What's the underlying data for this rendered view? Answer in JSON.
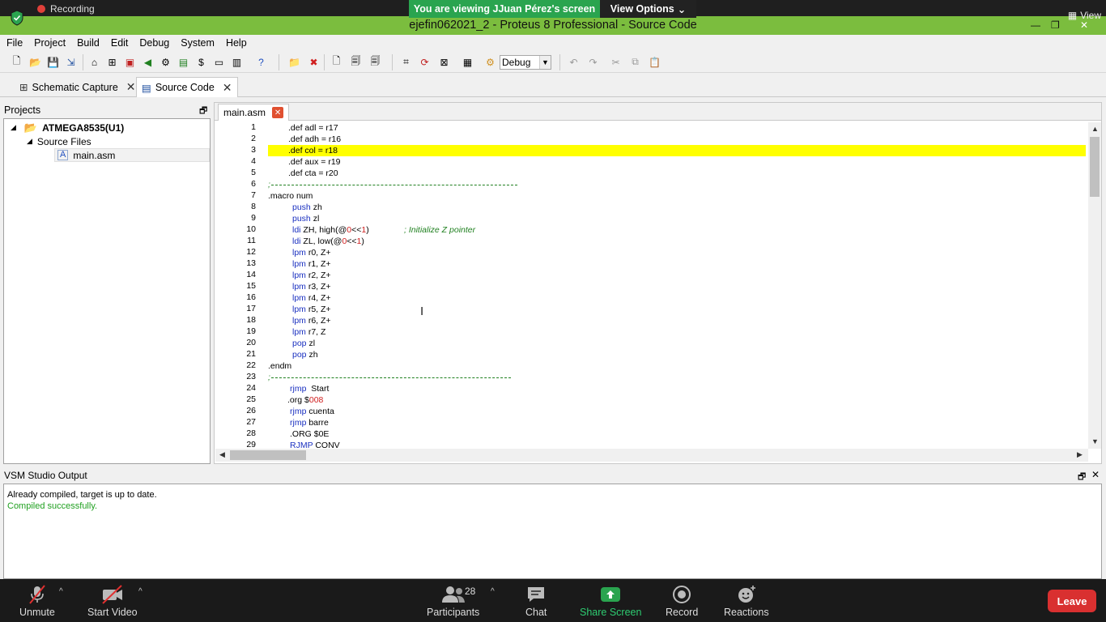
{
  "share_bar": {
    "recording": "Recording",
    "viewing": "You are viewing JJuan Pérez's screen",
    "view_options": "View Options",
    "view": "View"
  },
  "window": {
    "title": "ejefin062021_2 - Proteus 8 Professional - Source Code"
  },
  "menu": [
    "File",
    "Project",
    "Build",
    "Edit",
    "Debug",
    "System",
    "Help"
  ],
  "toolbar": {
    "config": "Debug"
  },
  "doc_tabs": [
    {
      "label": "Schematic Capture"
    },
    {
      "label": "Source Code"
    }
  ],
  "projects": {
    "header": "Projects",
    "root": "ATMEGA8535(U1)",
    "folder": "Source Files",
    "file": "main.asm"
  },
  "editor": {
    "tab": "main.asm",
    "line_numbers": [
      "1",
      "2",
      "3",
      "4",
      "5",
      "6",
      "7",
      "8",
      "9",
      "10",
      "11",
      "12",
      "13",
      "14",
      "15",
      "16",
      "17",
      "18",
      "19",
      "20",
      "21",
      "22",
      "23",
      "24",
      "25",
      "26",
      "27",
      "28",
      "29"
    ]
  },
  "code": {
    "l1": ".def adl = r17",
    "l2": ".def adh = r16",
    "l3": ".def col = r18",
    "l4": ".def aux = r19",
    "l5": ".def cta = r20",
    "l6": ";",
    "l7": ".macro num",
    "l8_kw": "push",
    "l8": " zh",
    "l9_kw": "push",
    "l9": " zl",
    "l10_kw": "ldi",
    "l10_a": " ZH, high(@",
    "l10_n": "0",
    "l10_b": "<<",
    "l10_n2": "1",
    "l10_c": ")",
    "l10_cmt": "; Initialize Z pointer",
    "l11_kw": "ldi",
    "l11_a": " ZL, low(@",
    "l11_n": "0",
    "l11_b": "<<",
    "l11_n2": "1",
    "l11_c": ")",
    "l12_kw": "lpm",
    "l12": " r0, Z+",
    "l13_kw": "lpm",
    "l13": " r1, Z+",
    "l14_kw": "lpm",
    "l14": " r2, Z+",
    "l15_kw": "lpm",
    "l15": " r3, Z+",
    "l16_kw": "lpm",
    "l16": " r4, Z+",
    "l17_kw": "lpm",
    "l17": " r5, Z+",
    "l18_kw": "lpm",
    "l18": " r6, Z+",
    "l19_kw": "lpm",
    "l19": " r7, Z",
    "l20_kw": "pop",
    "l20": " zl",
    "l21_kw": "pop",
    "l21": " zh",
    "l22": ".endm",
    "l23": ";",
    "l24_kw": "rjmp",
    "l24": "  Start",
    "l25_a": ".org $",
    "l25_n": "008",
    "l26_kw": "rjmp",
    "l26": " cuenta",
    "l27_kw": "rjmp",
    "l27": " barre",
    "l28": ".ORG $0E",
    "l29_kw": "RJMP",
    "l29": " CONV"
  },
  "output": {
    "header": "VSM Studio Output",
    "line1": "Already compiled, target is up to date.",
    "line2": "Compiled successfully."
  },
  "zoom": {
    "unmute": "Unmute",
    "start_video": "Start Video",
    "participants": "Participants",
    "participants_count": "28",
    "chat": "Chat",
    "share_screen": "Share Screen",
    "record": "Record",
    "reactions": "Reactions",
    "leave": "Leave"
  },
  "colors": {
    "share_border": "#7bbd3e",
    "highlight_line": "#ffff00",
    "keyword": "#1a30c0",
    "comment": "#208020",
    "leave": "#d93030"
  }
}
